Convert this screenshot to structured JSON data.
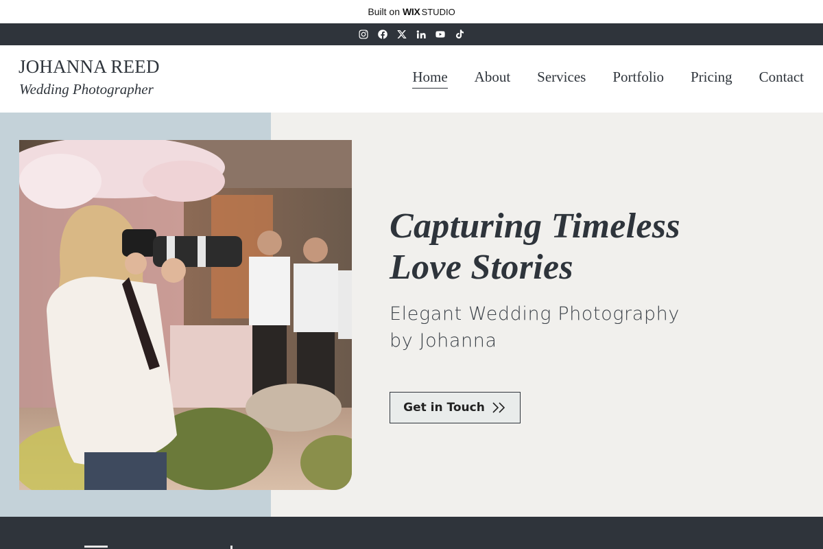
{
  "wix_banner": {
    "built_label": "Built on",
    "brand_label": "WIX",
    "brand_suffix": "STUDIO"
  },
  "social": [
    {
      "name": "instagram-icon"
    },
    {
      "name": "facebook-icon"
    },
    {
      "name": "x-icon"
    },
    {
      "name": "linkedin-icon"
    },
    {
      "name": "youtube-icon"
    },
    {
      "name": "tiktok-icon"
    }
  ],
  "header": {
    "name": "JOHANNA REED",
    "subtitle": "Wedding Photographer",
    "nav": [
      {
        "label": "Home",
        "active": true
      },
      {
        "label": "About"
      },
      {
        "label": "Services"
      },
      {
        "label": "Portfolio"
      },
      {
        "label": "Pricing"
      },
      {
        "label": "Contact"
      }
    ]
  },
  "hero": {
    "headline_line1": "Capturing Timeless",
    "headline_line2": "Love Stories",
    "subhead_line1": "Elegant Wedding Photography",
    "subhead_line2": "by Johanna",
    "cta_label": "Get in Touch",
    "cta_icon": "double-chevron-right-icon",
    "photo": "photographer-at-wedding-image"
  },
  "colors": {
    "dark": "#2f343b",
    "hero_left": "#c4d2d9",
    "hero_bg": "#f1f0ed",
    "text": "#2e343b"
  }
}
